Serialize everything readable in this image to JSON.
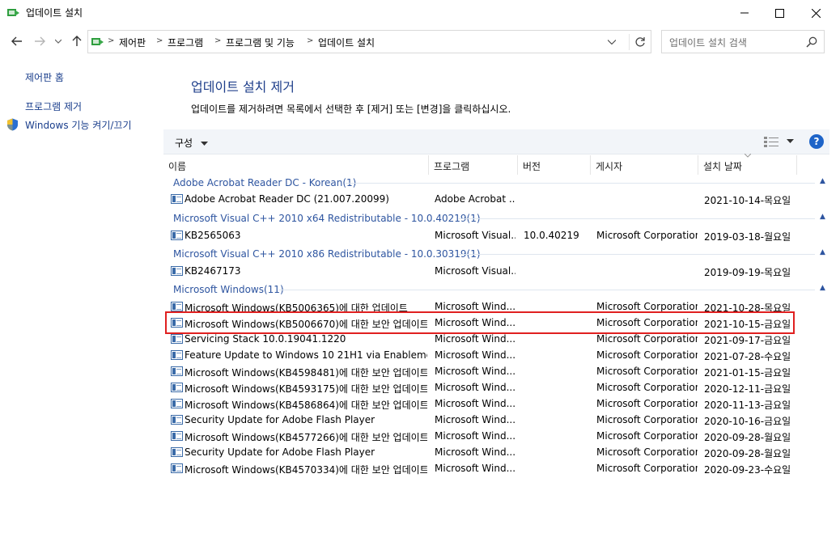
{
  "window": {
    "title": "업데이트 설치"
  },
  "address": {
    "crumbs": [
      "제어판",
      "프로그램",
      "프로그램 및 기능",
      "업데이트 설치"
    ]
  },
  "search": {
    "placeholder": "업데이트 설치 검색"
  },
  "left_pane": {
    "home": "제어판 홈",
    "uninstall": "프로그램 제거",
    "features": "Windows 기능 켜기/끄기"
  },
  "main": {
    "title": "업데이트 설치 제거",
    "description": "업데이트를 제거하려면 목록에서 선택한 후 [제거] 또는 [변경]을 클릭하십시오."
  },
  "toolbar": {
    "organize": "구성"
  },
  "columns": {
    "name": "이름",
    "program": "프로그램",
    "version": "버전",
    "publisher": "게시자",
    "installed": "설치 날짜"
  },
  "groups": [
    {
      "label": "Adobe Acrobat Reader DC - Korean(1)",
      "rows": [
        {
          "name": "Adobe Acrobat Reader DC  (21.007.20099)",
          "program": "Adobe Acrobat ...",
          "version": "",
          "publisher": "",
          "date": "2021-10-14-목요일"
        }
      ]
    },
    {
      "label": "Microsoft Visual C++ 2010  x64 Redistributable - 10.0.40219(1)",
      "rows": [
        {
          "name": "KB2565063",
          "program": "Microsoft Visual...",
          "version": "10.0.40219",
          "publisher": "Microsoft Corporation",
          "date": "2019-03-18-월요일"
        }
      ]
    },
    {
      "label": "Microsoft Visual C++ 2010  x86 Redistributable - 10.0.30319(1)",
      "rows": [
        {
          "name": "KB2467173",
          "program": "Microsoft Visual...",
          "version": "",
          "publisher": "",
          "date": "2019-09-19-목요일"
        }
      ]
    },
    {
      "label": "Microsoft Windows(11)",
      "rows": [
        {
          "name": "Microsoft Windows(KB5006365)에 대한 업데이트",
          "program": "Microsoft Wind...",
          "version": "",
          "publisher": "Microsoft Corporation",
          "date": "2021-10-28-목요일"
        },
        {
          "name": "Microsoft Windows(KB5006670)에 대한 보안 업데이트",
          "program": "Microsoft Wind...",
          "version": "",
          "publisher": "Microsoft Corporation",
          "date": "2021-10-15-금요일"
        },
        {
          "name": "Servicing Stack 10.0.19041.1220",
          "program": "Microsoft Wind...",
          "version": "",
          "publisher": "Microsoft Corporation",
          "date": "2021-09-17-금요일"
        },
        {
          "name": "Feature Update to Windows 10 21H1 via Enablement...",
          "program": "Microsoft Wind...",
          "version": "",
          "publisher": "Microsoft Corporation",
          "date": "2021-07-28-수요일"
        },
        {
          "name": "Microsoft Windows(KB4598481)에 대한 보안 업데이트",
          "program": "Microsoft Wind...",
          "version": "",
          "publisher": "Microsoft Corporation",
          "date": "2021-01-15-금요일"
        },
        {
          "name": "Microsoft Windows(KB4593175)에 대한 보안 업데이트",
          "program": "Microsoft Wind...",
          "version": "",
          "publisher": "Microsoft Corporation",
          "date": "2020-12-11-금요일"
        },
        {
          "name": "Microsoft Windows(KB4586864)에 대한 보안 업데이트",
          "program": "Microsoft Wind...",
          "version": "",
          "publisher": "Microsoft Corporation",
          "date": "2020-11-13-금요일"
        },
        {
          "name": "Security Update for Adobe Flash Player",
          "program": "Microsoft Wind...",
          "version": "",
          "publisher": "Microsoft Corporation",
          "date": "2020-10-16-금요일"
        },
        {
          "name": "Microsoft Windows(KB4577266)에 대한 보안 업데이트",
          "program": "Microsoft Wind...",
          "version": "",
          "publisher": "Microsoft Corporation",
          "date": "2020-09-28-월요일"
        },
        {
          "name": "Security Update for Adobe Flash Player",
          "program": "Microsoft Wind...",
          "version": "",
          "publisher": "Microsoft Corporation",
          "date": "2020-09-28-월요일"
        },
        {
          "name": "Microsoft Windows(KB4570334)에 대한 보안 업데이트",
          "program": "Microsoft Wind...",
          "version": "",
          "publisher": "Microsoft Corporation",
          "date": "2020-09-23-수요일"
        }
      ]
    }
  ],
  "colors": {
    "link": "#1a3e8c",
    "group": "#2e55a0",
    "highlight": "#e02020"
  }
}
